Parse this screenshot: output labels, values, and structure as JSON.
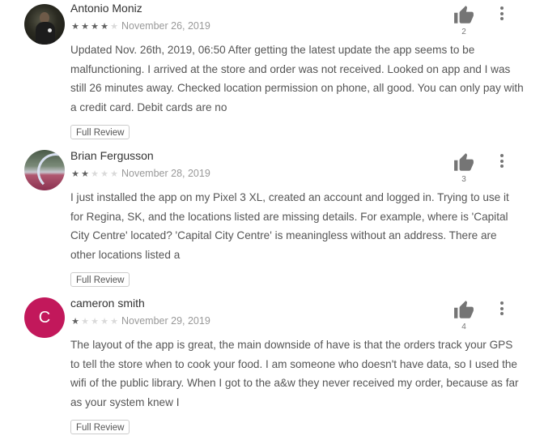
{
  "reviews": [
    {
      "author": "Antonio Moniz",
      "avatar": {
        "type": "photo"
      },
      "rating": 4,
      "date": "November 26, 2019",
      "text": "Updated Nov. 26th, 2019, 06:50 After getting the latest update the app seems to be malfunctioning. I arrived at the store and order was not received. Looked on app and I was still 26 minutes away. Checked location permission on phone, all good. You can only pay with a credit card. Debit cards are no",
      "full_review_label": "Full Review",
      "helpful_count": "2",
      "icons": {
        "helpful": "thumbs-up-icon",
        "more": "more-vert-icon"
      }
    },
    {
      "author": "Brian Fergusson",
      "avatar": {
        "type": "photo"
      },
      "rating": 2,
      "date": "November 28, 2019",
      "text": "I just installed the app on my Pixel 3 XL, created an account and logged in. Trying to use it for Regina, SK, and the locations listed are missing details. For example, where is 'Capital City Centre' located? 'Capital City Centre' is meaningless without an address. There are other locations listed a",
      "full_review_label": "Full Review",
      "helpful_count": "3",
      "icons": {
        "helpful": "thumbs-up-icon",
        "more": "more-vert-icon"
      }
    },
    {
      "author": "cameron smith",
      "avatar": {
        "type": "letter",
        "letter": "C",
        "color": "#c2185b"
      },
      "rating": 1,
      "date": "November 29, 2019",
      "text": "The layout of the app is great, the main downside of have is that the orders track your GPS to tell the store when to cook your food. I am someone who doesn't have data, so I used the wifi of the public library. When I got to the a&w they never received my order, because as far as your system knew I",
      "full_review_label": "Full Review",
      "helpful_count": "4",
      "icons": {
        "helpful": "thumbs-up-icon",
        "more": "more-vert-icon"
      }
    }
  ],
  "max_rating": 5,
  "colors": {
    "star_on": "#616161",
    "star_off": "#dadada",
    "icon": "#757575"
  }
}
